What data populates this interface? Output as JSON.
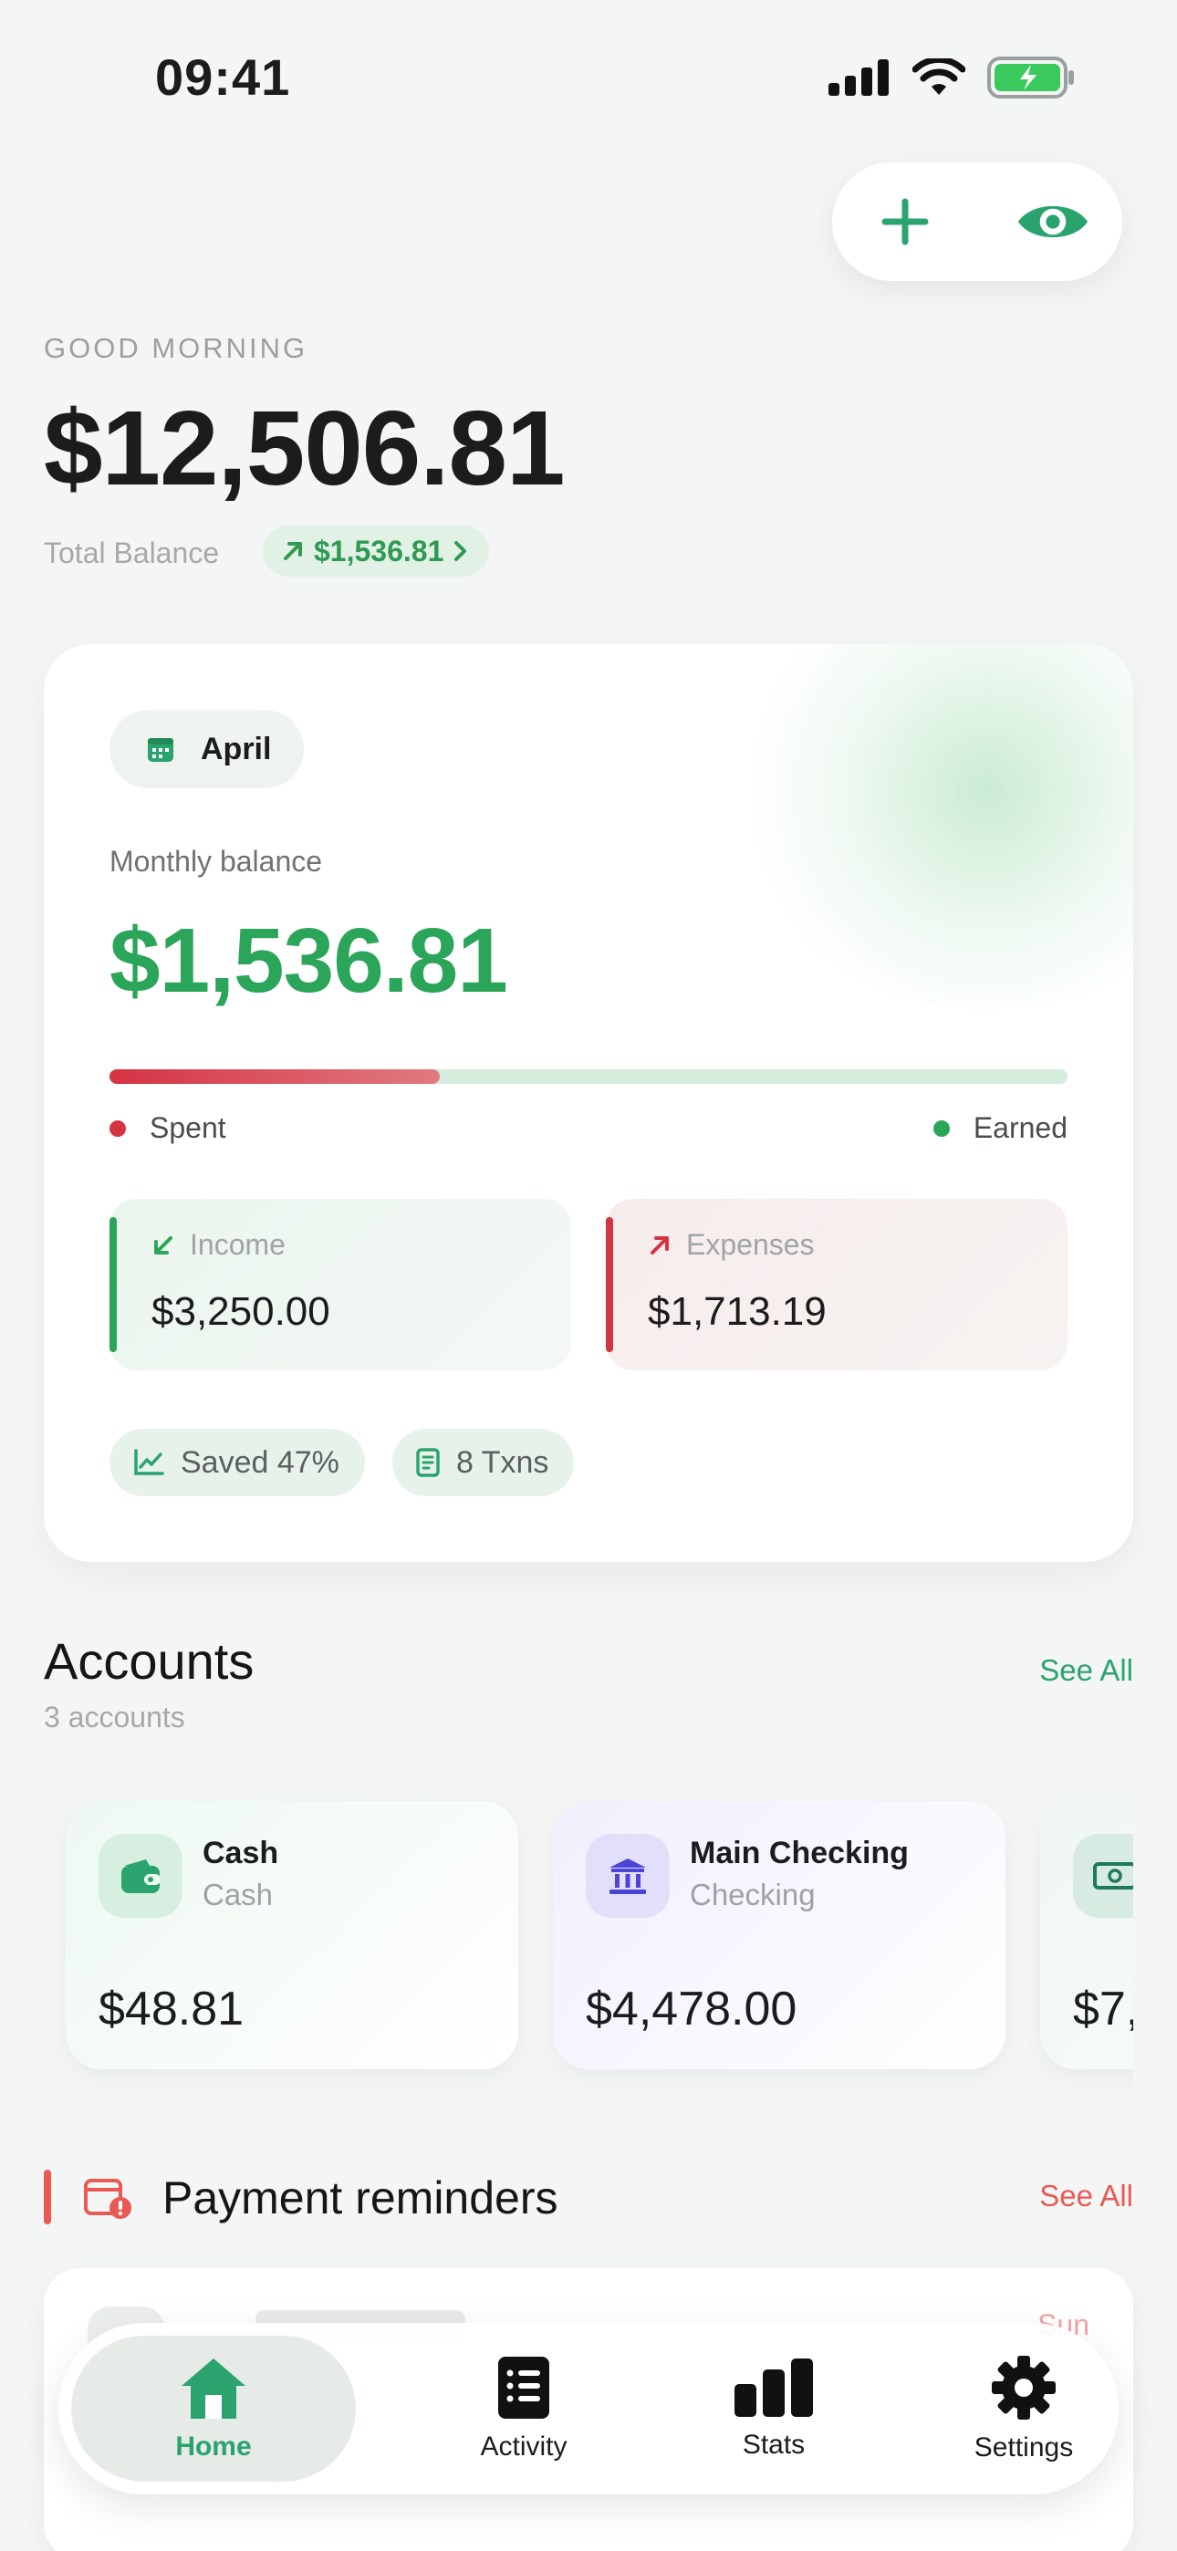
{
  "status_bar": {
    "time": "09:41"
  },
  "header": {
    "greeting": "GOOD MORNING",
    "total_balance": "$12,506.81",
    "total_label": "Total Balance",
    "delta": "$1,536.81"
  },
  "monthly_card": {
    "month": "April",
    "balance_label": "Monthly balance",
    "balance": "$1,536.81",
    "spent_fraction": 0.345,
    "legend_spent": "Spent",
    "legend_earned": "Earned",
    "income_label": "Income",
    "income_value": "$3,250.00",
    "expenses_label": "Expenses",
    "expenses_value": "$1,713.19",
    "saved_tag": "Saved 47%",
    "txns_tag": "8 Txns"
  },
  "accounts": {
    "title": "Accounts",
    "subtitle": "3 accounts",
    "see_all": "See All",
    "items": [
      {
        "name": "Cash",
        "type": "Cash",
        "balance": "$48.81",
        "icon": "wallet-icon"
      },
      {
        "name": "Main Checking",
        "type": "Checking",
        "balance": "$4,478.00",
        "icon": "bank-icon"
      },
      {
        "balance": "$7,",
        "icon": "banknote-icon"
      }
    ]
  },
  "reminders": {
    "title": "Payment reminders",
    "see_all": "See All",
    "peek_day": "Sun"
  },
  "nav": {
    "home": "Home",
    "activity": "Activity",
    "stats": "Stats",
    "settings": "Settings"
  },
  "colors": {
    "accent": "#2ba36e",
    "positive": "#2ba559",
    "negative": "#d63343",
    "reminder": "#ea5a55"
  }
}
